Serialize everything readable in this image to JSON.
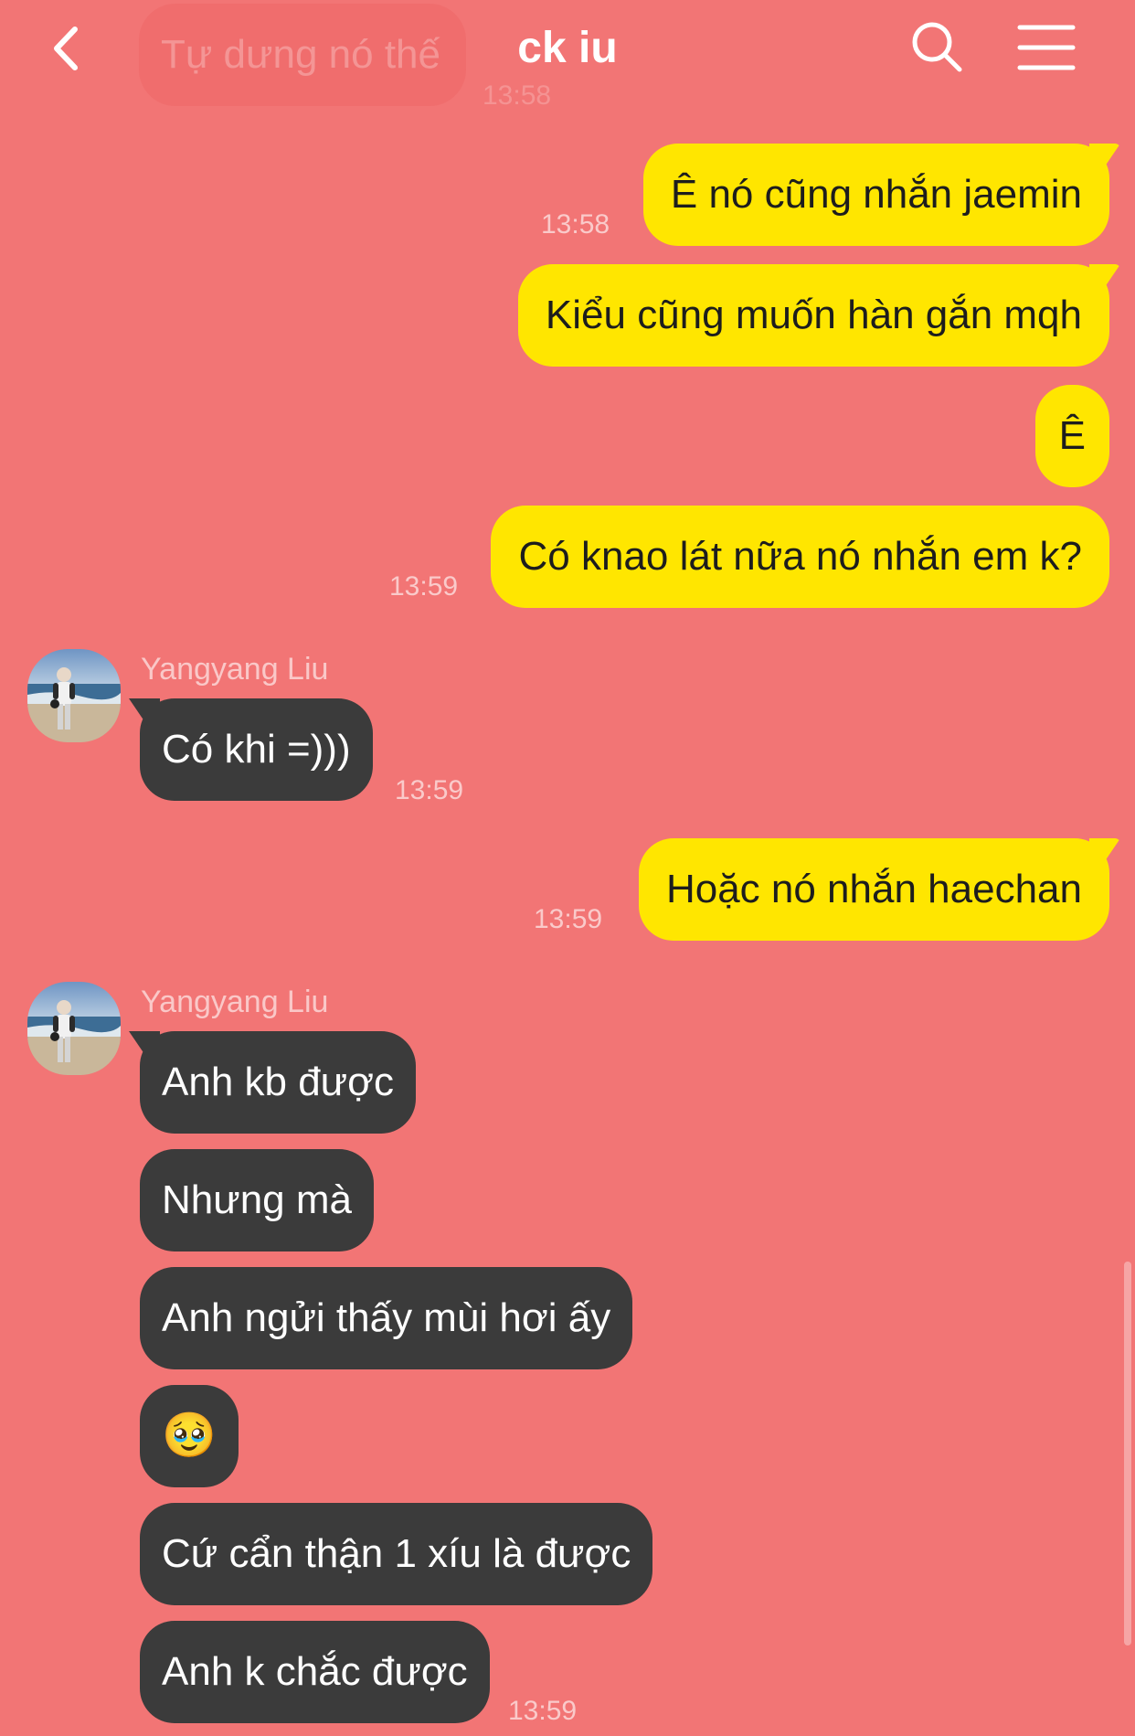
{
  "header": {
    "title": "ck iu"
  },
  "ghost": {
    "text": "Tự dưng nó thế",
    "time": "13:58"
  },
  "messages": [
    {
      "text": "Ê nó cũng nhắn jaemin",
      "time": "13:58"
    },
    {
      "text": "Kiểu cũng muốn hàn gắn mqh"
    },
    {
      "text": "Ê"
    },
    {
      "text": "Có knao lát nữa nó nhắn em k?",
      "time": "13:59"
    },
    {
      "sender": "Yangyang Liu",
      "text": "Có khi =)))",
      "time": "13:59"
    },
    {
      "text": "Hoặc nó nhắn haechan",
      "time": "13:59"
    },
    {
      "sender": "Yangyang Liu",
      "text": "Anh kb được"
    },
    {
      "text": "Nhưng mà"
    },
    {
      "text": "Anh ngửi thấy mùi hơi ấy"
    },
    {
      "text": "🥹"
    },
    {
      "text": "Cứ cẩn thận 1 xíu là được"
    },
    {
      "text": "Anh k chắc được",
      "time": "13:59"
    }
  ],
  "colors": {
    "background": "#f27575",
    "outgoing_bubble": "#ffe600",
    "incoming_bubble": "#3b3b3b"
  },
  "icons": {
    "back": "chevron-left-icon",
    "search": "search-icon",
    "menu": "hamburger-menu-icon"
  }
}
